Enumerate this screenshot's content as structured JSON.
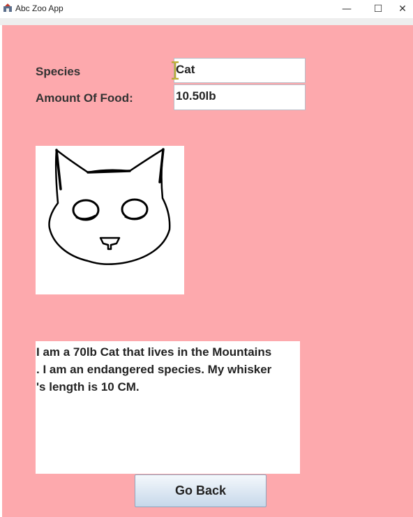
{
  "window": {
    "title": "Abc Zoo App",
    "minimize_glyph": "—",
    "maximize_glyph": "☐",
    "close_glyph": "✕"
  },
  "form": {
    "species_label": "Species",
    "species_value": "Cat",
    "food_label": "Amount Of Food:",
    "food_value": "10.50lb"
  },
  "image": {
    "icon": "cat-face-icon"
  },
  "description": {
    "lines": [
      "I am a 70lb Cat that lives in the Mountains",
      ". I am an endangered species. My whisker",
      "'s length is 10 CM."
    ]
  },
  "actions": {
    "go_back_label": "Go Back"
  },
  "colors": {
    "background": "#fda9ad",
    "panel": "#ffffff"
  }
}
